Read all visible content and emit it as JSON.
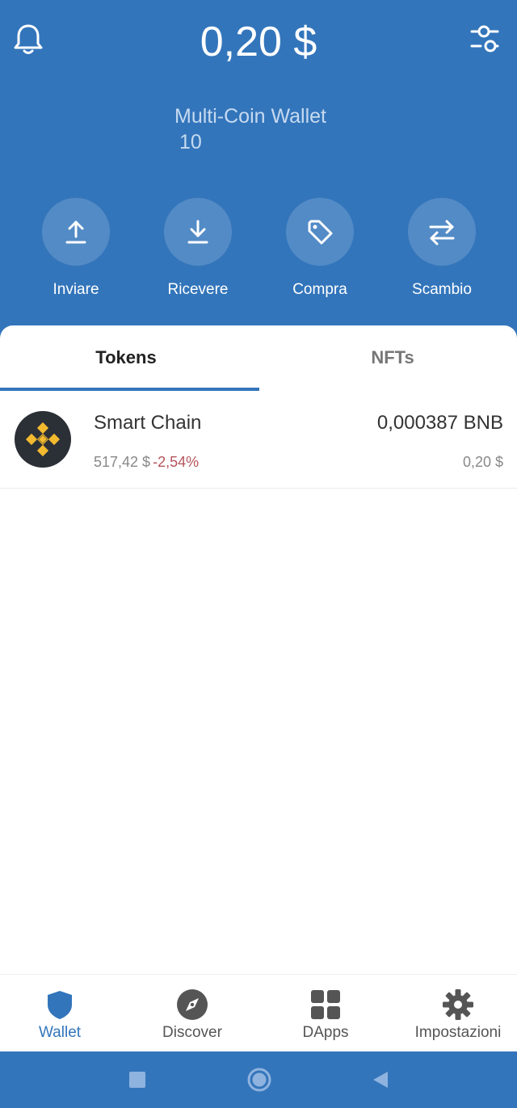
{
  "header": {
    "balance": "0,20 $",
    "wallet_name": "Multi-Coin Wallet",
    "wallet_number": "10",
    "bell_icon": "bell-icon",
    "filter_icon": "sliders-icon",
    "background_color": "#3375bb"
  },
  "actions": [
    {
      "label": "Inviare",
      "icon": "upload-arrow-icon"
    },
    {
      "label": "Ricevere",
      "icon": "download-arrow-icon"
    },
    {
      "label": "Compra",
      "icon": "price-tag-icon"
    },
    {
      "label": "Scambio",
      "icon": "swap-arrows-icon"
    }
  ],
  "tabs": {
    "tokens": "Tokens",
    "nfts": "NFTs",
    "active": "Tokens"
  },
  "tokens": [
    {
      "name": "Smart Chain",
      "price": "517,42 $",
      "change": "-2,54%",
      "amount": "0,000387 BNB",
      "fiat_value": "0,20 $",
      "logo_icon": "bnb-logo-icon",
      "change_color": "#b5545c"
    }
  ],
  "bottom_nav": {
    "items": [
      {
        "label": "Wallet",
        "icon": "shield-icon"
      },
      {
        "label": "Discover",
        "icon": "compass-icon"
      },
      {
        "label": "DApps",
        "icon": "grid-icon"
      },
      {
        "label": "Impostazioni",
        "icon": "gear-icon"
      }
    ],
    "active": "Wallet",
    "active_color": "#3375bb"
  },
  "system_bar": {
    "buttons": [
      "recents-square-icon",
      "home-circle-icon",
      "back-triangle-icon"
    ]
  }
}
